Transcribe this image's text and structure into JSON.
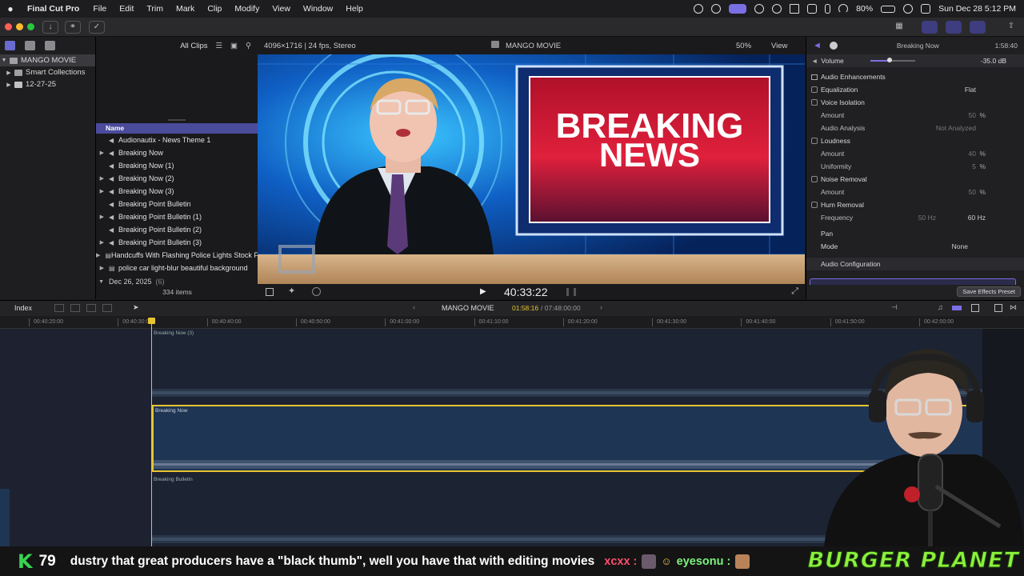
{
  "menubar": {
    "app_name": "Final Cut Pro",
    "items": [
      "File",
      "Edit",
      "Trim",
      "Mark",
      "Clip",
      "Modify",
      "View",
      "Window",
      "Help"
    ],
    "battery": "80%",
    "clock": "Sun Dec 28  5:12 PM"
  },
  "browser": {
    "filter": "All Clips",
    "libraries": [
      {
        "label": "MANGO MOVIE",
        "type": "library"
      },
      {
        "label": "Smart Collections",
        "type": "folder"
      },
      {
        "label": "12-27-25",
        "type": "event"
      }
    ],
    "column_name": "Name",
    "clips": [
      {
        "label": "Audionautix - News Theme 1",
        "icon": "audio-icon",
        "expand": false
      },
      {
        "label": "Breaking Now",
        "icon": "audio-icon",
        "expand": true
      },
      {
        "label": "Breaking Now (1)",
        "icon": "audio-icon",
        "expand": false
      },
      {
        "label": "Breaking Now (2)",
        "icon": "audio-icon",
        "expand": true
      },
      {
        "label": "Breaking Now (3)",
        "icon": "audio-icon",
        "expand": true
      },
      {
        "label": "Breaking Point Bulletin",
        "icon": "audio-icon",
        "expand": false
      },
      {
        "label": "Breaking Point Bulletin (1)",
        "icon": "audio-icon",
        "expand": true
      },
      {
        "label": "Breaking Point Bulletin (2)",
        "icon": "audio-icon",
        "expand": false
      },
      {
        "label": "Breaking Point Bulletin (3)",
        "icon": "audio-icon",
        "expand": true
      },
      {
        "label": "Handcuffs With Flashing Police Lights Stock Footage",
        "icon": "film-icon",
        "expand": true
      },
      {
        "label": "police car light-blur beautiful background",
        "icon": "film-icon",
        "expand": true
      }
    ],
    "date_group": "Dec 26, 2025",
    "date_group_count": "(6)",
    "item_count": "334 items"
  },
  "viewer": {
    "format": "4096×1716 | 24 fps, Stereo",
    "project": "MANGO MOVIE",
    "zoom": "50%",
    "view_menu": "View",
    "timecode": "40:33:22",
    "breaking": "BREAKING",
    "news": "NEWS"
  },
  "inspector": {
    "clip_name": "Breaking Now",
    "duration": "1:58:40",
    "volume_label": "Volume",
    "volume_value": "-35.0 dB",
    "volume_level": 0.42,
    "enhancements": "Audio Enhancements",
    "rows": [
      {
        "label": "Equalization",
        "value": "Flat",
        "check": true
      },
      {
        "label": "Voice Isolation",
        "value": "",
        "check": true
      },
      {
        "label": "Amount",
        "value": "50",
        "unit": "%",
        "check": false,
        "dim": true
      },
      {
        "label": "Audio Analysis",
        "value": "Not Analyzed",
        "check": false,
        "dim": true
      },
      {
        "label": "Loudness",
        "value": "",
        "check": true
      },
      {
        "label": "Amount",
        "value": "40",
        "unit": "%",
        "check": false,
        "dim": true
      },
      {
        "label": "Uniformity",
        "value": "5",
        "unit": "%",
        "check": false,
        "dim": true
      },
      {
        "label": "Noise Removal",
        "value": "",
        "check": true
      },
      {
        "label": "Amount",
        "value": "50",
        "unit": "%",
        "check": false,
        "dim": true
      },
      {
        "label": "Hum Removal",
        "value": "",
        "check": true
      },
      {
        "label": "Frequency",
        "value": "50 Hz",
        "alt": "60 Hz",
        "check": false,
        "dim": true
      }
    ],
    "pan": "Pan",
    "pan_mode_label": "Mode",
    "pan_mode_value": "None",
    "audio_config": "Audio Configuration",
    "save_preset": "Save Effects Preset"
  },
  "timeline": {
    "index": "Index",
    "project": "MANGO MOVIE",
    "position": "01:58:16",
    "total": "/ 07:48:00:00",
    "ruler": [
      "00:40:20:00",
      "00:40:30:00",
      "00:40:40:00",
      "00:40:50:00",
      "00:41:00:00",
      "00:41:10:00",
      "00:41:20:00",
      "00:41:30:00",
      "00:41:40:00",
      "00:41:50:00",
      "00:42:00:00"
    ],
    "clip_top": "Breaking Now (3)",
    "clip_main": "Breaking Now",
    "clip_bottom": "Breaking Bulletin"
  },
  "stream": {
    "platform_logo": "K",
    "viewers": "79",
    "marquee": "dustry that great producers have a \"black thumb\", well you have that with editing movies",
    "chat_user1": "xcxx :",
    "chat_user2": "eyesonu :",
    "sponsor": "BURGER PLANET"
  }
}
